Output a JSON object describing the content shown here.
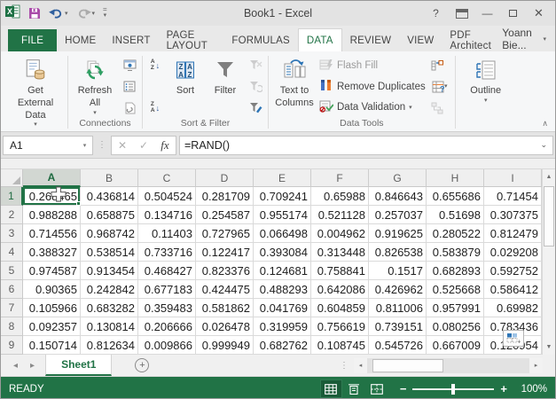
{
  "window": {
    "title": "Book1 - Excel"
  },
  "glyphs": {
    "caret_down": "▾",
    "chevron_up": "∧",
    "chevron_down": "⌄",
    "up": "▲",
    "down": "▼",
    "left": "◂",
    "right": "▸",
    "minimize": "—",
    "close": "✕",
    "help": "?",
    "dots": "⋮",
    "cancel": "✕",
    "check": "✓",
    "fx": "fx",
    "plus": "+",
    "minus": "−",
    "down_arrow": "↓",
    "a": "A",
    "z": "Z",
    "question": "?"
  },
  "tabs": {
    "items": [
      "FILE",
      "HOME",
      "INSERT",
      "PAGE LAYOUT",
      "FORMULAS",
      "DATA",
      "REVIEW",
      "VIEW",
      "PDF Architect"
    ],
    "active": "DATA",
    "user_name": "Yoann Bie..."
  },
  "ribbon": {
    "get_external_data": "Get External Data",
    "refresh_all": "Refresh All",
    "connections_label": "Connections",
    "sort": "Sort",
    "filter": "Filter",
    "sort_filter_label": "Sort & Filter",
    "text_to_columns": "Text to Columns",
    "flash_fill": "Flash Fill",
    "remove_duplicates": "Remove Duplicates",
    "data_validation": "Data Validation",
    "data_tools_label": "Data Tools",
    "outline": "Outline"
  },
  "formula_bar": {
    "name_box": "A1",
    "formula": "=RAND()"
  },
  "grid": {
    "active_cell": "A1",
    "selected_column": "A",
    "selected_row": "1",
    "columns": [
      "A",
      "B",
      "C",
      "D",
      "E",
      "F",
      "G",
      "H",
      "I"
    ],
    "rows": [
      {
        "n": "1",
        "cells": [
          "0.268465",
          "0.436814",
          "0.504524",
          "0.281709",
          "0.709241",
          "0.65988",
          "0.846643",
          "0.655686",
          "0.71454"
        ]
      },
      {
        "n": "2",
        "cells": [
          "0.988288",
          "0.658875",
          "0.134716",
          "0.254587",
          "0.955174",
          "0.521128",
          "0.257037",
          "0.51698",
          "0.307375"
        ]
      },
      {
        "n": "3",
        "cells": [
          "0.714556",
          "0.968742",
          "0.11403",
          "0.727965",
          "0.066498",
          "0.004962",
          "0.919625",
          "0.280522",
          "0.812479"
        ]
      },
      {
        "n": "4",
        "cells": [
          "0.388327",
          "0.538514",
          "0.733716",
          "0.122417",
          "0.393084",
          "0.313448",
          "0.826538",
          "0.583879",
          "0.029208"
        ]
      },
      {
        "n": "5",
        "cells": [
          "0.974587",
          "0.913454",
          "0.468427",
          "0.823376",
          "0.124681",
          "0.758841",
          "0.1517",
          "0.682893",
          "0.592752"
        ]
      },
      {
        "n": "6",
        "cells": [
          "0.90365",
          "0.242842",
          "0.677183",
          "0.424475",
          "0.488293",
          "0.642086",
          "0.426962",
          "0.525668",
          "0.586412"
        ]
      },
      {
        "n": "7",
        "cells": [
          "0.105966",
          "0.683282",
          "0.359483",
          "0.581862",
          "0.041769",
          "0.604859",
          "0.811006",
          "0.957991",
          "0.69982"
        ]
      },
      {
        "n": "8",
        "cells": [
          "0.092357",
          "0.130814",
          "0.206666",
          "0.026478",
          "0.319959",
          "0.756619",
          "0.739151",
          "0.080256",
          "0.783436"
        ]
      },
      {
        "n": "9",
        "cells": [
          "0.150714",
          "0.812634",
          "0.009866",
          "0.999949",
          "0.682762",
          "0.108745",
          "0.545726",
          "0.667009",
          "0.120954"
        ]
      }
    ]
  },
  "sheet_bar": {
    "active_sheet": "Sheet1"
  },
  "status_bar": {
    "mode": "READY",
    "zoom": "100%"
  },
  "colors": {
    "excel_green": "#217346",
    "active_cell_border": "#217346",
    "status_bar": "#217346"
  }
}
